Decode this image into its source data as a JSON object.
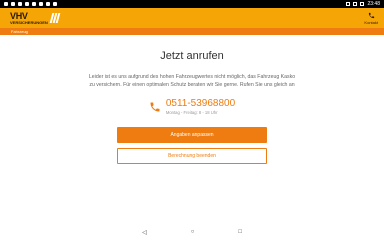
{
  "status_bar": {
    "time": "23:48",
    "left_icons": [
      "whatsapp-icon",
      "mail-icon",
      "instagram-icon",
      "camera-icon",
      "gallery-icon",
      "android-icon",
      "location-icon",
      "sync-icon"
    ],
    "right_icons": [
      "wifi-icon",
      "signal-icon",
      "battery-icon"
    ]
  },
  "header": {
    "logo_top": "VHV",
    "logo_bottom": "VERSICHERUNGEN",
    "contact_label": "Kontakt"
  },
  "subheader": {
    "label": "Fahrzeug"
  },
  "main": {
    "title": "Jetzt anrufen",
    "message": "Leider ist es uns aufgrund des hohen Fahrzeugwertes nicht möglich, das Fahrzeug Kasko zu versichern. Für einen optimalen Schutz beraten wir Sie gerne. Rufen Sie uns gleich an",
    "phone_number": "0511-53968800",
    "phone_hours": "Montag - Freitag: 8 - 18 Uhr",
    "primary_button": "Angaben anpassen",
    "secondary_button": "Berechnung beenden"
  },
  "colors": {
    "brand_yellow": "#f5a506",
    "brand_orange": "#ee7c10"
  }
}
